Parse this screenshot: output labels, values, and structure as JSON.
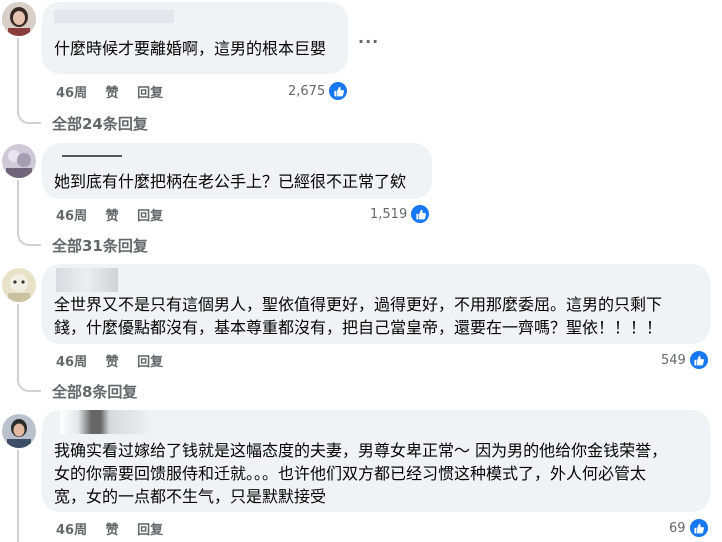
{
  "comments": [
    {
      "text": [
        "什麼時候才要離婚啊，這男的根本巨嬰"
      ],
      "time": "46周",
      "like_label": "赞",
      "reply_label": "回复",
      "likes": "2,675",
      "more_label": "...",
      "replies": "全部24条回复"
    },
    {
      "text": [
        "她到底有什麼把柄在老公手上？已經很不正常了欸"
      ],
      "time": "46周",
      "like_label": "赞",
      "reply_label": "回复",
      "likes": "1,519",
      "replies": "全部31条回复"
    },
    {
      "text": [
        "全世界又不是只有這個男人，聖依值得更好，過得更好，不用那麼委屈。這男的只剩下",
        "錢，什麼優點都沒有，基本尊重都沒有，把自己當皇帝，還要在一齊嗎？聖依！！！！"
      ],
      "time": "46周",
      "like_label": "赞",
      "reply_label": "回复",
      "likes": "549",
      "replies": "全部8条回复"
    },
    {
      "text": [
        "我确实看过嫁给了钱就是这幅态度的夫妻，男尊女卑正常～ 因为男的他给你金钱荣誉，",
        "女的你需要回馈服侍和迁就。。。也许他们双方都已经习惯这种模式了，外人何必管太",
        "宽，女的一点都不生气，只是默默接受"
      ],
      "time": "46周",
      "like_label": "赞",
      "reply_label": "回复",
      "likes": "69"
    }
  ],
  "colors": {
    "accent": "#1877f2",
    "bubble": "#f0f2f5",
    "meta": "#65676b"
  },
  "icons": {
    "like": "thumbs-up-icon",
    "more": "more-options-icon"
  }
}
